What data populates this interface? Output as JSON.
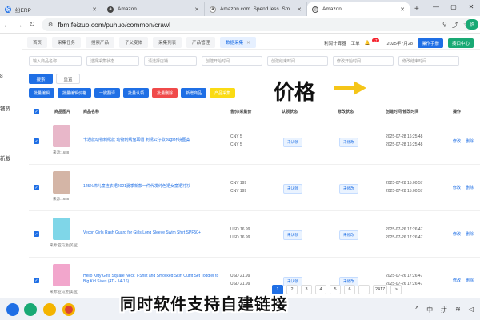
{
  "browser": {
    "tabs": [
      {
        "title": "纷ERP",
        "icon": "erp-icon",
        "icon_color": "#1f6fe5"
      },
      {
        "title": "Amazon",
        "icon": "amazon-icon",
        "icon_color": "#444444"
      },
      {
        "title": "Amazon.com. Spend less. Sm",
        "icon": "amazon-a-icon",
        "icon_color": "#222222"
      },
      {
        "title": "Amazon",
        "icon": "globe-icon",
        "icon_color": "#555555",
        "active": true
      }
    ],
    "url": "fbm.feizuo.com/puhuo/common/crawl",
    "extension_label": "临"
  },
  "sidebar": {
    "items": [
      {
        "label": "8"
      },
      {
        "label": "铺货"
      },
      {
        "label": "新版"
      }
    ]
  },
  "app_nav": {
    "tabs": [
      {
        "label": "首页"
      },
      {
        "label": "采集任务"
      },
      {
        "label": "搜索产品"
      },
      {
        "label": "子父变体"
      },
      {
        "label": "采集列表"
      },
      {
        "label": "产品管理"
      },
      {
        "label": "数据采集",
        "active": true
      }
    ],
    "right": {
      "profit_calc": "利润计算器",
      "workorder": "工单",
      "notice_count": "17",
      "date": "2025年7月28",
      "btn_blue": "操作手册",
      "btn_green": "接口中心"
    }
  },
  "filters": [
    {
      "placeholder": "输入商品名称"
    },
    {
      "placeholder": "选择采集状态"
    },
    {
      "placeholder": "请选择店铺"
    },
    {
      "placeholder": "创建开始时间"
    },
    {
      "placeholder": "创建结束时间"
    },
    {
      "placeholder": "修改开始时间"
    },
    {
      "placeholder": "修改结束时间"
    }
  ],
  "actions": {
    "search": "搜索",
    "reset": "重置"
  },
  "toolbar": [
    {
      "label": "批量编辑",
      "color": "blue"
    },
    {
      "label": "批量编辑价格",
      "color": "blue"
    },
    {
      "label": "一键翻译",
      "color": "blue"
    },
    {
      "label": "批量认领",
      "color": "blue"
    },
    {
      "label": "批量删除",
      "color": "red"
    },
    {
      "label": "新增商品",
      "color": "blue"
    },
    {
      "label": "产品采集",
      "color": "yellow"
    }
  ],
  "overlay": {
    "price": "价格",
    "subtitle": "同时软件支持自建链接"
  },
  "table": {
    "headers": [
      "商品图片",
      "商品名称",
      "售价/采集价",
      "认领状态",
      "修改状态",
      "创建时间/修改时间",
      "操作"
    ],
    "rows": [
      {
        "thumb_color": "#e8b7c9",
        "source": "来源:1688",
        "name": "卡通款动物刺绣款 动物刺绣兔耳帽 刺绣公仔款bugs环境图案",
        "price": [
          "CNY 5",
          "CNY 5"
        ],
        "claim": "未认领",
        "modify": "未修改",
        "times": [
          "2025-07-28 16:25:48",
          "2025-07-28 16:25:48"
        ],
        "ops": [
          "修改",
          "删除"
        ]
      },
      {
        "thumb_color": "#d4b5a6",
        "source": "来源:1688",
        "name": "125%棉儿童连衣裙2021夏季新款一件代发纯色裙女童裙衬衫",
        "price": [
          "CNY 199",
          "CNY 199"
        ],
        "claim": "未认领",
        "modify": "未修改",
        "times": [
          "2025-07-28 15:00:57",
          "2025-07-28 15:00:57"
        ],
        "ops": [
          "修改",
          "删除"
        ]
      },
      {
        "thumb_color": "#7fd6e8",
        "source": "来源:亚马逊(美国)",
        "name": "Vecon Girls Rash Guard for Girls Long Sleeve Swim Shirt SPF50+",
        "price": [
          "USD 16.99",
          "USD 16.99"
        ],
        "claim": "未认领",
        "modify": "未修改",
        "times": [
          "2025-07-26 17:26:47",
          "2025-07-26 17:26:47"
        ],
        "ops": [
          "修改",
          "删除"
        ]
      },
      {
        "thumb_color": "#f2a6cc",
        "source": "来源:亚马逊(美国)",
        "name": "Hello Kitty Girls Square Neck T-Shirt and Smocked Skirt Outfit Set Toddler to Big Kid Sizes (4T - 14-16)",
        "price": [
          "USD 21.99",
          "USD 21.99"
        ],
        "claim": "未认领",
        "modify": "未修改",
        "times": [
          "2025-07-26 17:26:47",
          "2025-07-26 17:26:47"
        ],
        "ops": [
          "修改",
          "删除"
        ]
      }
    ]
  },
  "pagination": {
    "pages": [
      "1",
      "2",
      "3",
      "4",
      "5",
      "6",
      "...",
      "2417"
    ],
    "active": "1",
    "next": ">"
  },
  "taskbar": {
    "ime_lang": "中",
    "ime_mode": "拼"
  }
}
